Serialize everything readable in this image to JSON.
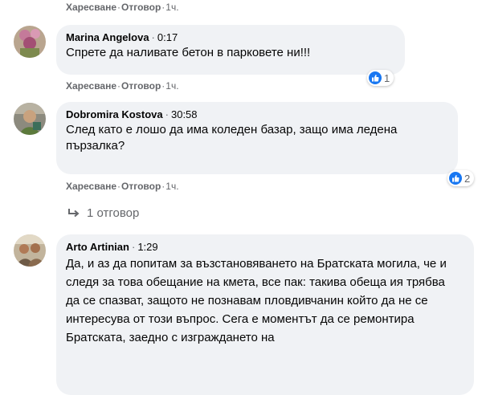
{
  "labels": {
    "like": "Харесване",
    "reply": "Отговор",
    "separator": "·"
  },
  "top_actions": {
    "time": "1ч."
  },
  "comments": [
    {
      "author": "Marina Angelova",
      "timestamp": "0:17",
      "text": "Спрете да наливате бетон в парковете ни!!!",
      "reaction_count": "1",
      "time": "1ч."
    },
    {
      "author": "Dobromira Kostova",
      "timestamp": "30:58",
      "text": "След като е лошо да има коледен базар, защо има ледена пързалка?",
      "reaction_count": "2",
      "time": "1ч.",
      "replies_label": "1 отговор"
    },
    {
      "author": "Arto Artinian",
      "timestamp": "1:29",
      "text": "Да, и аз да попитам за възстановяването на Братската могила, че и следя за това обещание на кмета, все пак: такива обеща ия трябва да се спазват, защото не познавам пловдивчанин който да не се интересува от този въпрос. Сега е моментът да се ремонтира Братската, заедно с изграждането на"
    }
  ],
  "colors": {
    "bubble": "#f0f2f5",
    "like": "#1877f2",
    "secondary_text": "#65676b"
  },
  "icons": {
    "reaction": "thumbs-up-icon",
    "reply_arrow": "reply-arrow-icon"
  }
}
